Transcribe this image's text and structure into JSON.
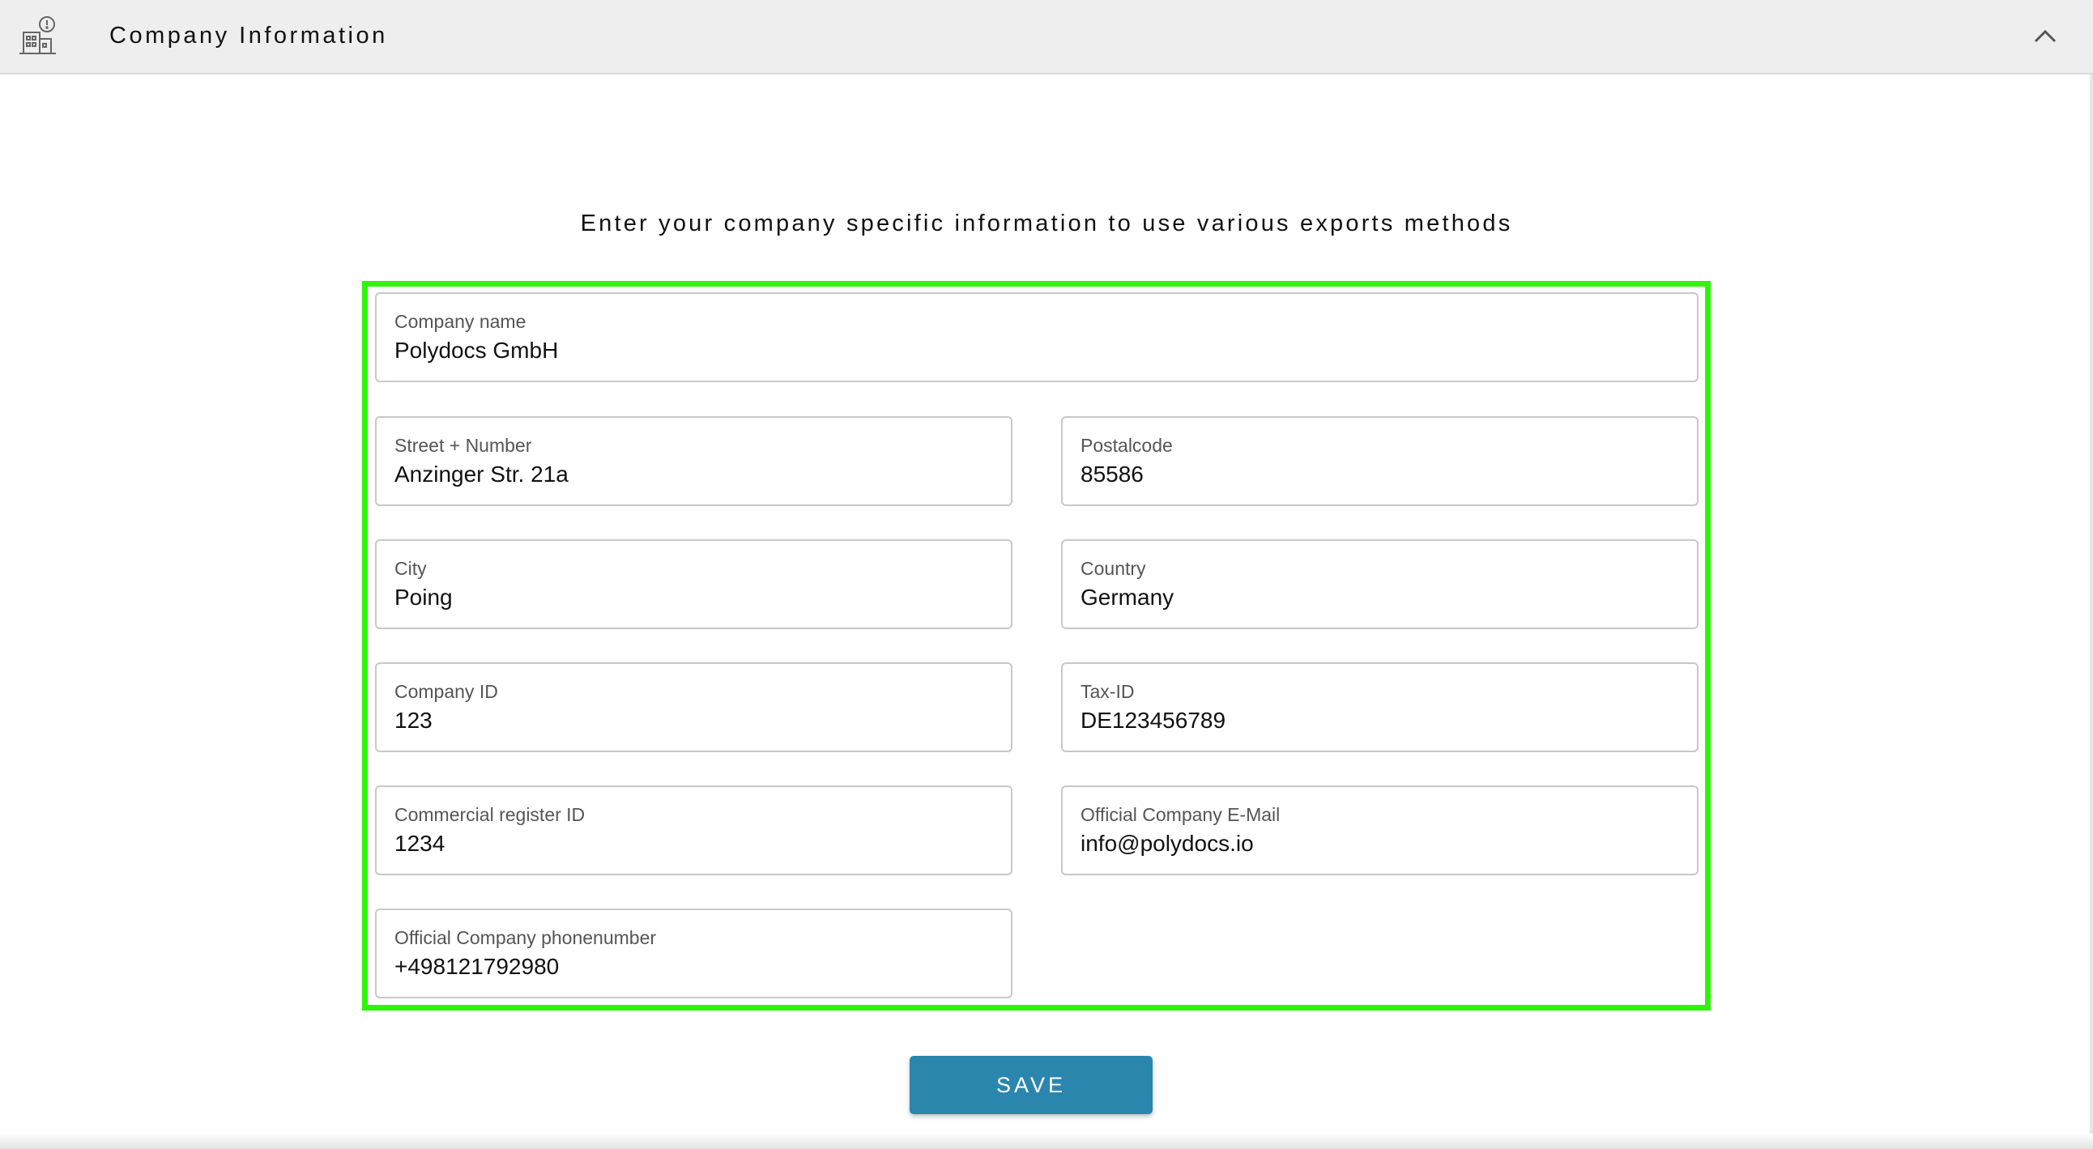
{
  "header": {
    "title": "Company Information",
    "icon": "company-building-icon",
    "collapse_icon": "chevron-up-icon"
  },
  "subtitle": "Enter your company specific information to use various exports methods",
  "form": {
    "company_name": {
      "label": "Company name",
      "value": "Polydocs GmbH"
    },
    "street": {
      "label": "Street + Number",
      "value": "Anzinger Str. 21a"
    },
    "postalcode": {
      "label": "Postalcode",
      "value": "85586"
    },
    "city": {
      "label": "City",
      "value": "Poing"
    },
    "country": {
      "label": "Country",
      "value": "Germany"
    },
    "company_id": {
      "label": "Company ID",
      "value": "123"
    },
    "tax_id": {
      "label": "Tax-ID",
      "value": "DE123456789"
    },
    "commercial_register_id": {
      "label": "Commercial register ID",
      "value": "1234"
    },
    "email": {
      "label": "Official Company E-Mail",
      "value": "info@polydocs.io"
    },
    "phone": {
      "label": "Official Company phonenumber",
      "value": "+498121792980"
    }
  },
  "save_label": "SAVE",
  "colors": {
    "highlight_border": "#2ef50a",
    "save_button": "#2a86ad",
    "header_background": "#eeeeee"
  }
}
